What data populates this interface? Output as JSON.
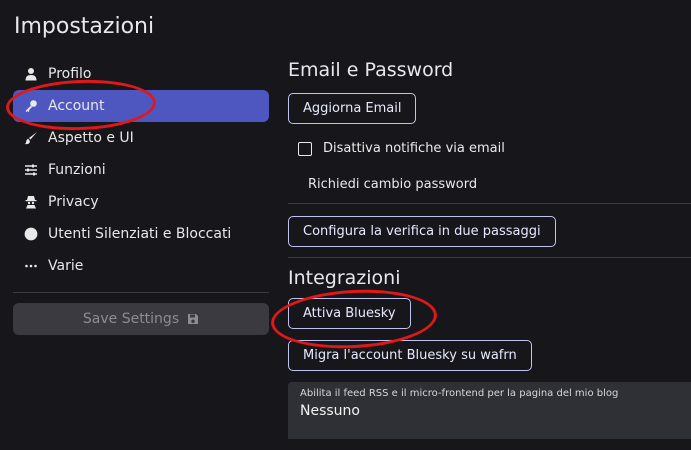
{
  "sidebar": {
    "title": "Impostazioni",
    "items": [
      {
        "label": "Profilo",
        "icon": "user-icon"
      },
      {
        "label": "Account",
        "icon": "key-icon",
        "active": true
      },
      {
        "label": "Aspetto e UI",
        "icon": "brush-icon"
      },
      {
        "label": "Funzioni",
        "icon": "sliders-icon"
      },
      {
        "label": "Privacy",
        "icon": "spy-icon"
      },
      {
        "label": "Utenti Silenziati e Bloccati",
        "icon": "ban-icon"
      },
      {
        "label": "Varie",
        "icon": "ellipsis-icon"
      }
    ],
    "save_label": "Save Settings"
  },
  "main": {
    "email_section_title": "Email e Password",
    "update_email_label": "Aggiorna Email",
    "disable_email_notifications_label": "Disattiva notifiche via email",
    "disable_email_notifications_checked": false,
    "request_password_change_label": "Richiedi cambio password",
    "configure_2fa_label": "Configura la verifica in due passaggi",
    "integrations_title": "Integrazioni",
    "activate_bluesky_label": "Attiva Bluesky",
    "migrate_bluesky_label": "Migra l'account Bluesky su wafrn",
    "rss_select": {
      "label": "Abilita il feed RSS e il micro-frontend per la pagina del mio blog",
      "value": "Nessuno"
    }
  },
  "colors": {
    "background": "#17171b",
    "active_nav": "#4e56c0",
    "annotation_ring": "#e01818",
    "button_border": "#bfc3ee"
  }
}
